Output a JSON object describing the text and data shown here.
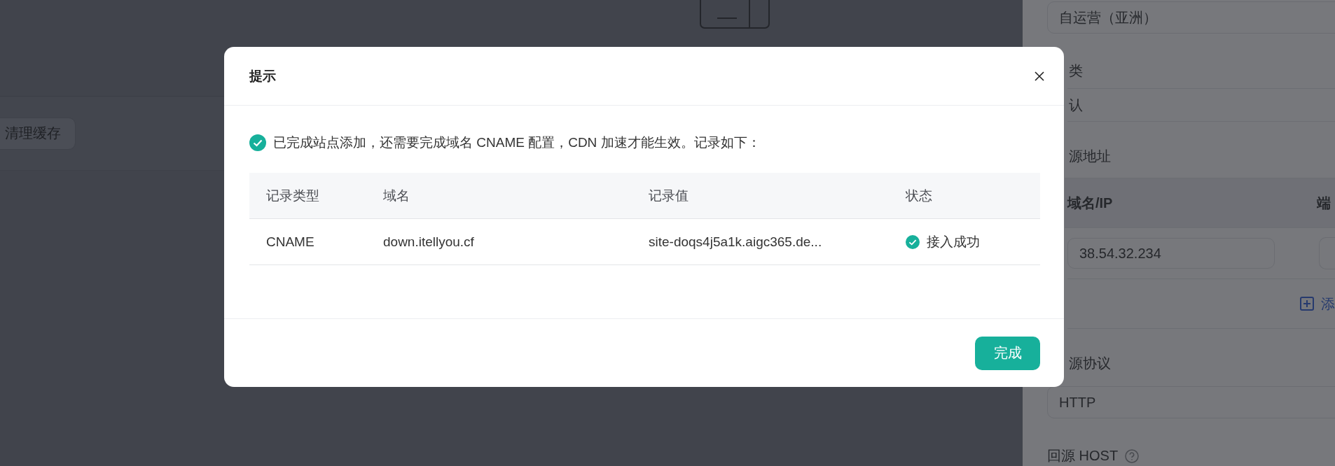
{
  "background": {
    "clear_cache_button": "清理缓存"
  },
  "side_panel": {
    "region_field": "自运营（亚洲）",
    "category_label": "类",
    "category_value": "认",
    "origin_label": "源地址",
    "origin_columns": [
      "域名/IP",
      "端"
    ],
    "origin_ip_field": "38.54.32.234",
    "add_link": "添",
    "protocol_label": "源协议",
    "protocol_field": "HTTP",
    "host_label": "回源 HOST"
  },
  "modal": {
    "title": "提示",
    "message": "已完成站点添加，还需要完成域名 CNAME 配置，CDN 加速才能生效。记录如下：",
    "columns": [
      "记录类型",
      "域名",
      "记录值",
      "状态"
    ],
    "rows": [
      {
        "cells": [
          "CNAME",
          "down.itellyou.cf",
          "site-doqs4j5a1k.aigc365.de..."
        ],
        "status": {
          "text": "接入成功",
          "kind": "success"
        }
      }
    ],
    "primary_button": "完成"
  }
}
